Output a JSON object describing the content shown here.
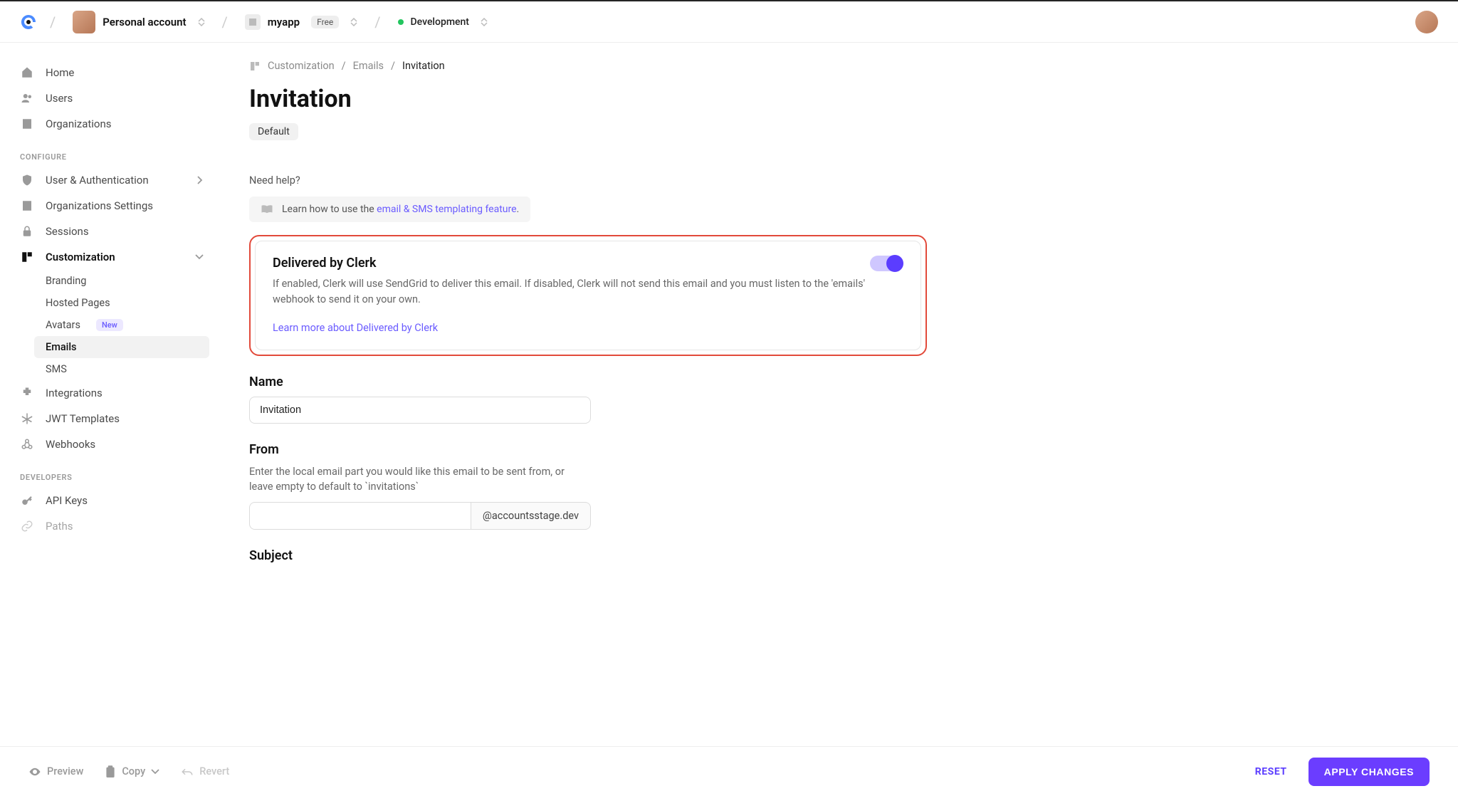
{
  "header": {
    "account_name": "Personal account",
    "app_name": "myapp",
    "plan": "Free",
    "environment": "Development"
  },
  "sidebar": {
    "main": [
      {
        "label": "Home"
      },
      {
        "label": "Users"
      },
      {
        "label": "Organizations"
      }
    ],
    "section_configure": "CONFIGURE",
    "configure": [
      {
        "label": "User & Authentication"
      },
      {
        "label": "Organizations Settings"
      },
      {
        "label": "Sessions"
      },
      {
        "label": "Customization"
      },
      {
        "label": "Integrations"
      },
      {
        "label": "JWT Templates"
      },
      {
        "label": "Webhooks"
      }
    ],
    "customization_children": [
      {
        "label": "Branding"
      },
      {
        "label": "Hosted Pages"
      },
      {
        "label": "Avatars",
        "new_label": "New"
      },
      {
        "label": "Emails"
      },
      {
        "label": "SMS"
      }
    ],
    "section_developers": "DEVELOPERS",
    "developers": [
      {
        "label": "API Keys"
      },
      {
        "label": "Paths"
      }
    ]
  },
  "breadcrumb": {
    "a": "Customization",
    "b": "Emails",
    "c": "Invitation"
  },
  "page_title": "Invitation",
  "badge": "Default",
  "help": {
    "label": "Need help?",
    "prefix": "Learn how to use the ",
    "link": "email & SMS templating feature",
    "suffix": "."
  },
  "delivered_card": {
    "title": "Delivered by Clerk",
    "desc": "If enabled, Clerk will use SendGrid to deliver this email. If disabled, Clerk will not send this email and you must listen to the 'emails' webhook to send it on your own.",
    "link": "Learn more about Delivered by Clerk",
    "toggle_on": true
  },
  "form": {
    "name_label": "Name",
    "name_value": "Invitation",
    "from_label": "From",
    "from_desc": "Enter the local email part you would like this email to be sent from, or leave empty to default to `invitations`",
    "from_value": "",
    "from_domain": "@accountsstage.dev",
    "subject_label": "Subject"
  },
  "footer": {
    "preview": "Preview",
    "copy": "Copy",
    "revert": "Revert",
    "reset": "RESET",
    "apply": "APPLY CHANGES"
  }
}
